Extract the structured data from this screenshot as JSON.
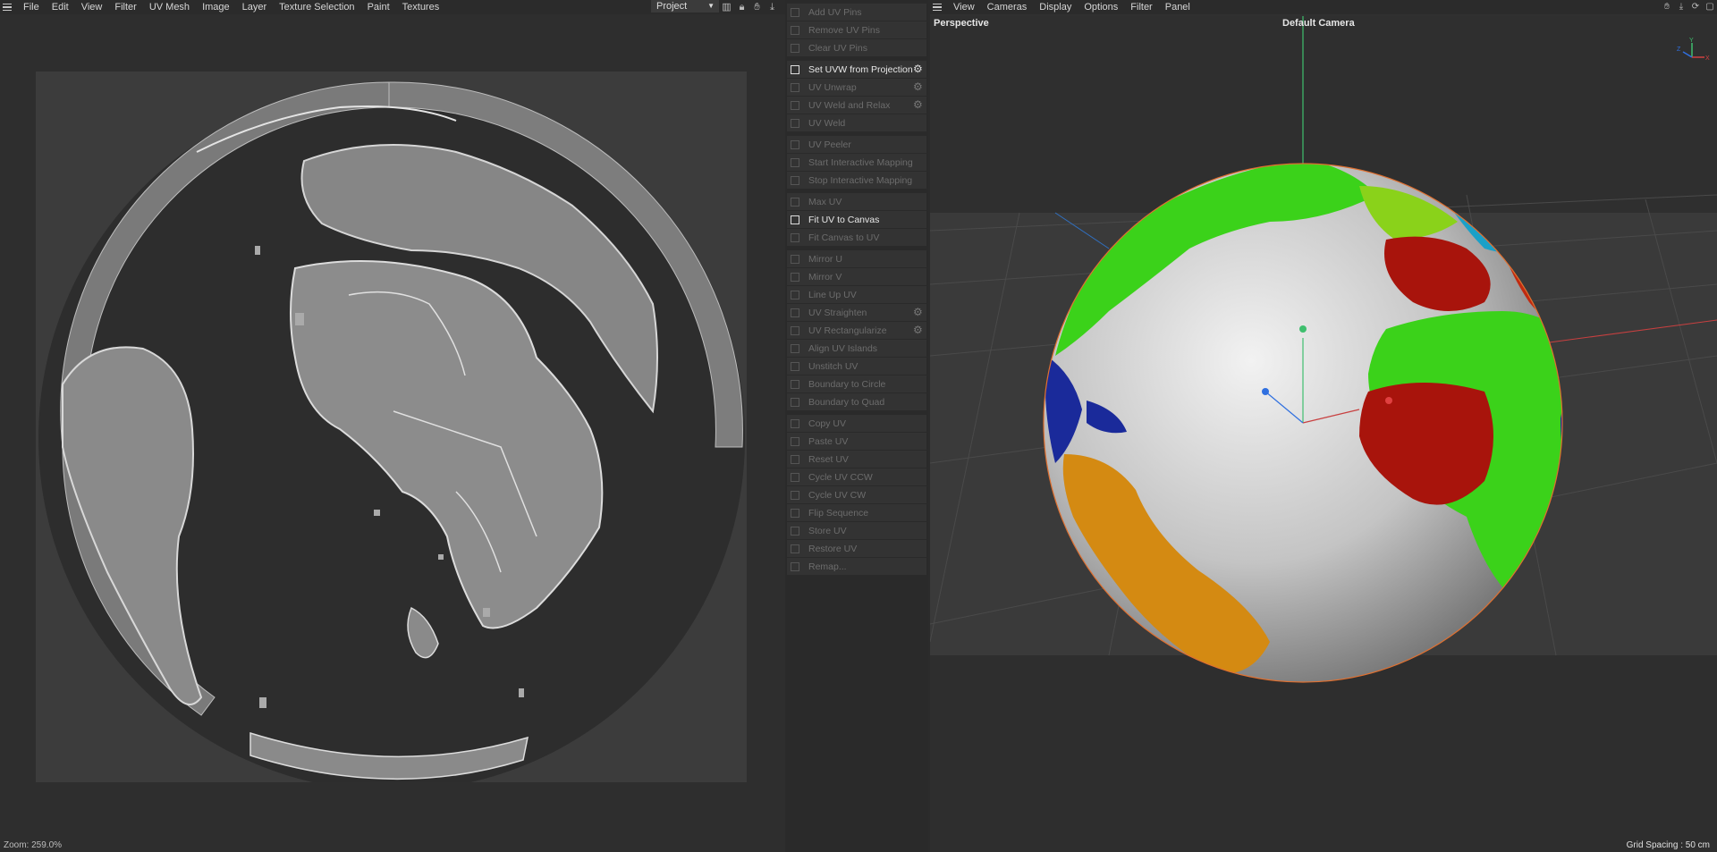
{
  "left": {
    "menu": [
      "File",
      "Edit",
      "View",
      "Filter",
      "UV Mesh",
      "Image",
      "Layer",
      "Texture Selection",
      "Paint",
      "Textures"
    ],
    "project_dropdown": "Project",
    "status": "Zoom: 259.0%"
  },
  "commands": {
    "group1": [
      {
        "label": "Add UV Pins",
        "enabled": false,
        "gear": false
      },
      {
        "label": "Remove UV Pins",
        "enabled": false,
        "gear": false
      },
      {
        "label": "Clear UV Pins",
        "enabled": false,
        "gear": false
      }
    ],
    "group2": [
      {
        "label": "Set UVW from Projection",
        "enabled": true,
        "gear": true
      },
      {
        "label": "UV Unwrap",
        "enabled": false,
        "gear": true
      },
      {
        "label": "UV Weld and Relax",
        "enabled": false,
        "gear": true
      },
      {
        "label": "UV Weld",
        "enabled": false,
        "gear": false
      }
    ],
    "group3": [
      {
        "label": "UV Peeler",
        "enabled": false,
        "gear": false
      },
      {
        "label": "Start Interactive Mapping",
        "enabled": false,
        "gear": false
      },
      {
        "label": "Stop Interactive Mapping",
        "enabled": false,
        "gear": false
      }
    ],
    "group4": [
      {
        "label": "Max UV",
        "enabled": false,
        "gear": false
      },
      {
        "label": "Fit UV to Canvas",
        "enabled": true,
        "gear": false
      },
      {
        "label": "Fit Canvas to UV",
        "enabled": false,
        "gear": false
      }
    ],
    "group5": [
      {
        "label": "Mirror U",
        "enabled": false,
        "gear": false
      },
      {
        "label": "Mirror V",
        "enabled": false,
        "gear": false
      },
      {
        "label": "Line Up UV",
        "enabled": false,
        "gear": false
      },
      {
        "label": "UV Straighten",
        "enabled": false,
        "gear": true
      },
      {
        "label": "UV Rectangularize",
        "enabled": false,
        "gear": true
      },
      {
        "label": "Align UV Islands",
        "enabled": false,
        "gear": false
      },
      {
        "label": "Unstitch UV",
        "enabled": false,
        "gear": false
      },
      {
        "label": "Boundary to Circle",
        "enabled": false,
        "gear": false
      },
      {
        "label": "Boundary to Quad",
        "enabled": false,
        "gear": false
      }
    ],
    "group6": [
      {
        "label": "Copy UV",
        "enabled": false,
        "gear": false
      },
      {
        "label": "Paste UV",
        "enabled": false,
        "gear": false
      },
      {
        "label": "Reset UV",
        "enabled": false,
        "gear": false
      },
      {
        "label": "Cycle UV CCW",
        "enabled": false,
        "gear": false
      },
      {
        "label": "Cycle UV CW",
        "enabled": false,
        "gear": false
      },
      {
        "label": "Flip Sequence",
        "enabled": false,
        "gear": false
      },
      {
        "label": "Store UV",
        "enabled": false,
        "gear": false
      },
      {
        "label": "Restore UV",
        "enabled": false,
        "gear": false
      },
      {
        "label": "Remap...",
        "enabled": false,
        "gear": false
      }
    ]
  },
  "right": {
    "menu": [
      "View",
      "Cameras",
      "Display",
      "Options",
      "Filter",
      "Panel"
    ],
    "view_label": "Perspective",
    "camera_label": "Default Camera",
    "grid_spacing": "Grid Spacing : 50 cm",
    "axis": {
      "y": "Y",
      "x": "X",
      "z": "Z"
    }
  },
  "colors": {
    "land_green": "#3bd21a",
    "land_red": "#a8140c",
    "land_orange": "#d48a12",
    "land_blue": "#1a2a9a",
    "land_cyan": "#1aa0c8",
    "globe": "#cfcfcf"
  }
}
